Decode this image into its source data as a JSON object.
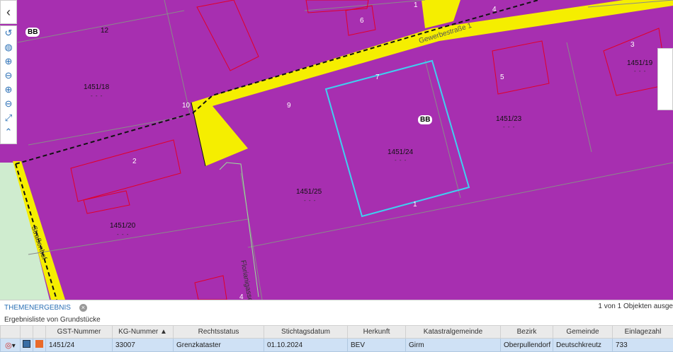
{
  "map": {
    "zone_label": "BB",
    "street_main": "Gewerbestraße 1",
    "street_left": "Straßenhof",
    "street_bottom": "Florianigasse",
    "parcels": [
      {
        "id": "1451/18",
        "sub": "- - -"
      },
      {
        "id": "1451/20",
        "sub": "- - -"
      },
      {
        "id": "1451/25",
        "sub": "- - -"
      },
      {
        "id": "1451/24",
        "sub": "- - -"
      },
      {
        "id": "1451/23",
        "sub": "- - -"
      },
      {
        "id": "1451/19",
        "sub": "- - -"
      }
    ],
    "numbers": [
      "12",
      "2",
      "10",
      "9",
      "7",
      "1",
      "6",
      "4",
      "1",
      "5",
      "3",
      "1",
      "4"
    ],
    "colors": {
      "zone": "#a72fb0",
      "road": "#f5ee00",
      "highlight": "#3fd0f0",
      "buildings": "#e0002a"
    }
  },
  "toolbar": {
    "collapse_icon": "chevron-left-icon",
    "buttons": [
      {
        "name": "refresh-icon",
        "glyph": "↺"
      },
      {
        "name": "globe-icon",
        "glyph": "◍"
      },
      {
        "name": "zoom-in-icon",
        "glyph": "⊕"
      },
      {
        "name": "zoom-out-icon",
        "glyph": "⊖"
      },
      {
        "name": "zoom-in-2-icon",
        "glyph": "⊕"
      },
      {
        "name": "zoom-out-2-icon",
        "glyph": "⊖"
      },
      {
        "name": "fullscreen-icon",
        "glyph": "⤢"
      },
      {
        "name": "collapse-up-icon",
        "glyph": "⌃"
      }
    ]
  },
  "results": {
    "tab_label": "THEMENERGEBNIS",
    "count_text": "1 von 1 Objekten ausge",
    "list_title": "Ergebnisliste von Grundstücke",
    "columns": [
      "GST-Nummer",
      "KG-Nummer ▲",
      "Rechtsstatus",
      "Stichtagsdatum",
      "Herkunft",
      "Katastralgemeinde",
      "Bezirk",
      "Gemeinde",
      "Einlagezahl"
    ],
    "rows": [
      [
        "1451/24",
        "33007",
        "Grenzkataster",
        "01.10.2024",
        "BEV",
        "Girm",
        "Oberpullendorf",
        "Deutschkreutz",
        "733"
      ]
    ]
  }
}
